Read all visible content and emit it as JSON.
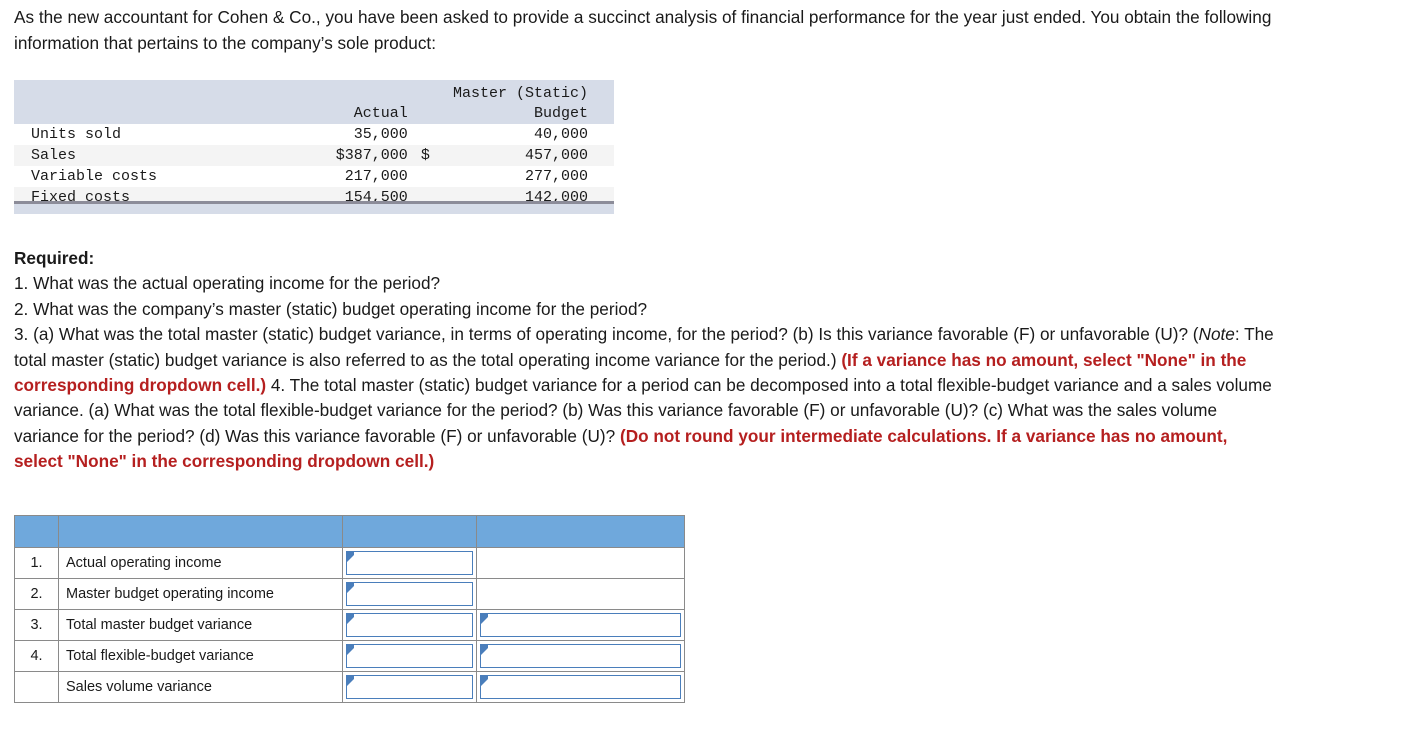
{
  "intro": {
    "text": "As the new accountant for Cohen & Co., you have been asked to provide a succinct analysis of financial performance for the year just ended. You obtain the following information that pertains to the company’s sole product:"
  },
  "data_table": {
    "headers": {
      "blank": "",
      "actual": "Actual",
      "dollar": "",
      "budget_line1": "Master (Static)",
      "budget_line2": "Budget"
    },
    "rows": [
      {
        "label": "Units sold",
        "actual": "35,000",
        "dollar": "",
        "budget": "40,000"
      },
      {
        "label": "Sales",
        "actual": "$387,000",
        "dollar": "$",
        "budget": "457,000"
      },
      {
        "label": "Variable costs",
        "actual": "217,000",
        "dollar": "",
        "budget": "277,000"
      },
      {
        "label": "Fixed costs",
        "actual": "154,500",
        "dollar": "",
        "budget": "142,000"
      }
    ]
  },
  "required": {
    "heading": "Required:",
    "q1": "1. What was the actual operating income for the period?",
    "q2": "2. What was the company’s master (static) budget operating income for the period?",
    "q3_part_a": "3. (a) What was the total master (static) budget variance, in terms of operating income, for the period? (b) Is this variance favorable (F) or unfavorable (U)? (",
    "q3_note_italic": "Note",
    "q3_part_b": ": The total master (static) budget variance is also referred to as the total operating income variance for the period.) ",
    "q3_red": "(If a variance has no amount, select \"None\" in the corresponding dropdown cell.)",
    "q4_part_a": "4. The total master (static) budget variance for a period can be decomposed into a total flexible-budget variance and a sales volume variance. (a) What was the total flexible-budget variance for the period? (b) Was this variance favorable (F) or unfavorable (U)? (c) What was the sales volume variance for the period? (d) Was this variance favorable (F) or unfavorable (U)? ",
    "q4_red": "(Do not round your intermediate calculations. If a variance has no amount, select \"None\" in the corresponding dropdown cell.)"
  },
  "answer_table": {
    "header": {
      "num": "",
      "desc": "",
      "val": "",
      "uf": ""
    },
    "rows": [
      {
        "num": "1.",
        "desc": "Actual operating income",
        "val": "",
        "uf": "",
        "val_input": true,
        "uf_input": false
      },
      {
        "num": "2.",
        "desc": "Master budget operating income",
        "val": "",
        "uf": "",
        "val_input": true,
        "uf_input": false
      },
      {
        "num": "3.",
        "desc": "Total master budget variance",
        "val": "",
        "uf": "",
        "val_input": true,
        "uf_input": true
      },
      {
        "num": "4.",
        "desc": "Total flexible-budget variance",
        "val": "",
        "uf": "",
        "val_input": true,
        "uf_input": true
      },
      {
        "num": "",
        "desc": "Sales volume variance",
        "val": "",
        "uf": "",
        "val_input": true,
        "uf_input": true
      }
    ]
  },
  "colors": {
    "red_emphasis": "#b51f1f",
    "table_header_blue": "#6fa8dc",
    "data_header_gray": "#d6dce8",
    "input_border_blue": "#4a7ebb"
  }
}
